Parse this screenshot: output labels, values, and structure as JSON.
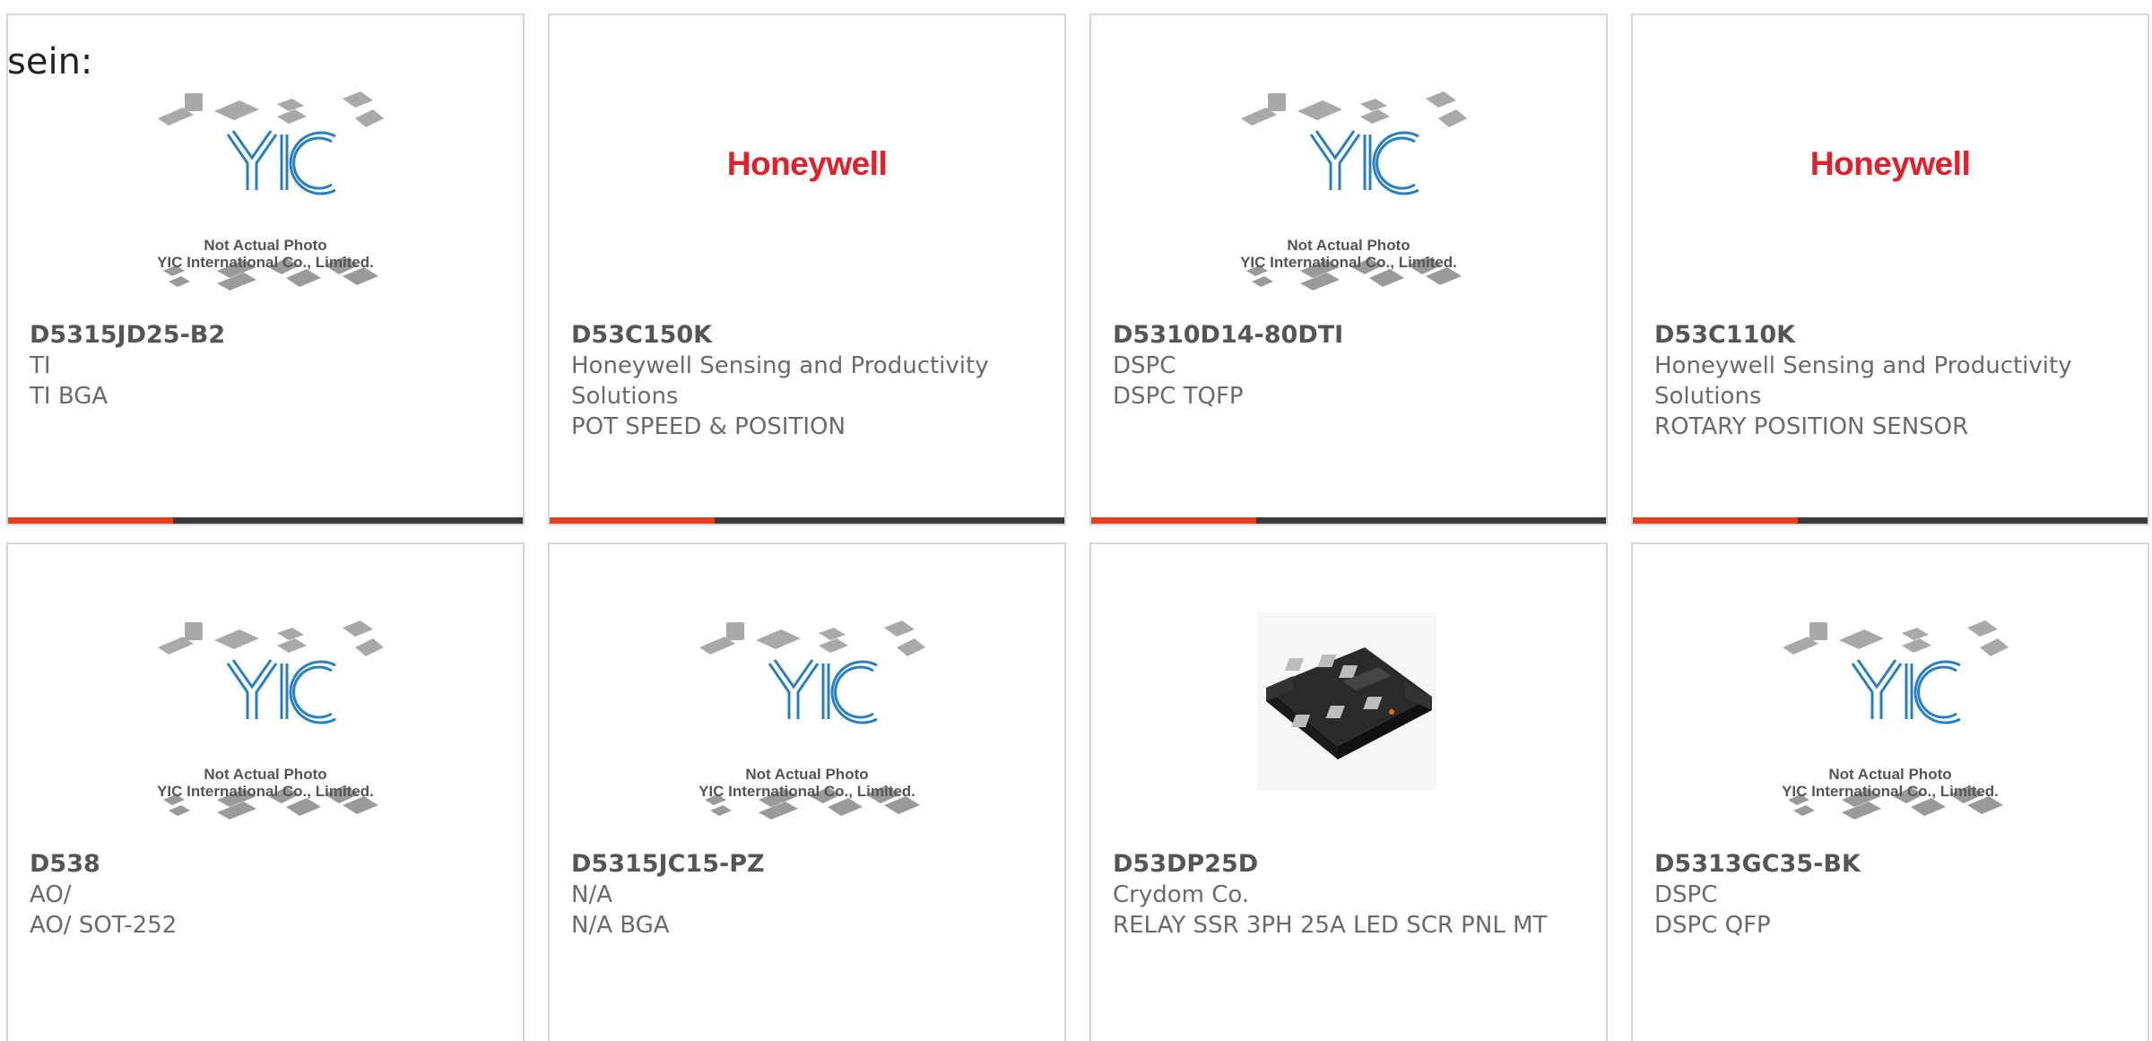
{
  "header": {
    "lead_text": "sein:"
  },
  "placeholder": {
    "logo_text": "YIC",
    "caption_line1": "Not Actual Photo",
    "caption_line2": "YIC International Co., Limited."
  },
  "brand_logo_text": "Honeywell",
  "colors": {
    "accent": "#e8401a",
    "bar": "#3a3a3a",
    "honeywell_red": "#e0202a",
    "yic_blue": "#2a7fc0"
  },
  "products": [
    {
      "part_number": "D5315JD25-B2",
      "manufacturer": "TI",
      "description": "TI BGA",
      "image": "yic-placeholder"
    },
    {
      "part_number": "D53C150K",
      "manufacturer": "Honeywell Sensing and Productivity Solutions",
      "description": "POT SPEED & POSITION",
      "image": "honeywell-logo"
    },
    {
      "part_number": "D5310D14-80DTI",
      "manufacturer": "DSPC",
      "description": "DSPC TQFP",
      "image": "yic-placeholder"
    },
    {
      "part_number": "D53C110K",
      "manufacturer": "Honeywell Sensing and Productivity Solutions",
      "description": "ROTARY POSITION SENSOR",
      "image": "honeywell-logo"
    },
    {
      "part_number": "D538",
      "manufacturer": "AO/",
      "description": "AO/ SOT-252",
      "image": "yic-placeholder"
    },
    {
      "part_number": "D5315JC15-PZ",
      "manufacturer": "N/A",
      "description": "N/A BGA",
      "image": "yic-placeholder"
    },
    {
      "part_number": "D53DP25D",
      "manufacturer": "Crydom Co.",
      "description": "RELAY SSR 3PH 25A LED SCR PNL MT",
      "image": "relay-photo"
    },
    {
      "part_number": "D5313GC35-BK",
      "manufacturer": "DSPC",
      "description": "DSPC QFP",
      "image": "yic-placeholder"
    }
  ]
}
